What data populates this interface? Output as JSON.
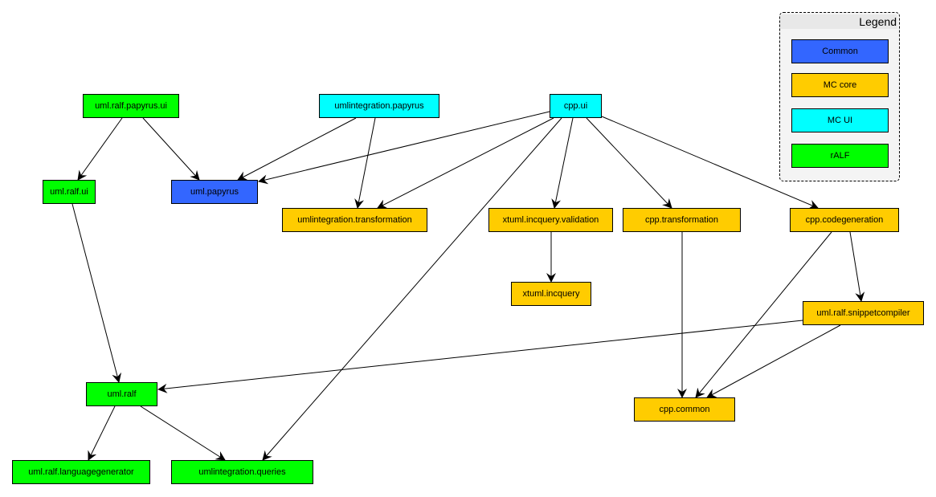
{
  "colors": {
    "Common": "#3366ff",
    "MC core": "#ffcc00",
    "MC UI": "#00ffff",
    "rALF": "#00ff00"
  },
  "legend": {
    "title": "Legend",
    "items": [
      {
        "label": "Common",
        "category": "Common"
      },
      {
        "label": "MC core",
        "category": "MC core"
      },
      {
        "label": "MC UI",
        "category": "MC UI"
      },
      {
        "label": "rALF",
        "category": "rALF"
      }
    ]
  },
  "nodes": [
    {
      "id": "uml.ralf.papyrus.ui",
      "label": "uml.ralf.papyrus.ui",
      "category": "rALF"
    },
    {
      "id": "umlintegration.papyrus",
      "label": "umlintegration.papyrus",
      "category": "MC UI"
    },
    {
      "id": "cpp.ui",
      "label": "cpp.ui",
      "category": "MC UI"
    },
    {
      "id": "uml.ralf.ui",
      "label": "uml.ralf.ui",
      "category": "rALF"
    },
    {
      "id": "uml.papyrus",
      "label": "uml.papyrus",
      "category": "Common"
    },
    {
      "id": "umlintegration.transformation",
      "label": "umlintegration.transformation",
      "category": "MC core"
    },
    {
      "id": "xtuml.incquery.validation",
      "label": "xtuml.incquery.validation",
      "category": "MC core"
    },
    {
      "id": "cpp.transformation",
      "label": "cpp.transformation",
      "category": "MC core"
    },
    {
      "id": "cpp.codegeneration",
      "label": "cpp.codegeneration",
      "category": "MC core"
    },
    {
      "id": "xtuml.incquery",
      "label": "xtuml.incquery",
      "category": "MC core"
    },
    {
      "id": "uml.ralf.snippetcompiler",
      "label": "uml.ralf.snippetcompiler",
      "category": "MC core"
    },
    {
      "id": "uml.ralf",
      "label": "uml.ralf",
      "category": "rALF"
    },
    {
      "id": "cpp.common",
      "label": "cpp.common",
      "category": "MC core"
    },
    {
      "id": "uml.ralf.languagegenerator",
      "label": "uml.ralf.languagegenerator",
      "category": "rALF"
    },
    {
      "id": "umlintegration.queries",
      "label": "umlintegration.queries",
      "category": "rALF"
    }
  ],
  "edges": [
    {
      "from": "uml.ralf.papyrus.ui",
      "to": "uml.ralf.ui"
    },
    {
      "from": "uml.ralf.papyrus.ui",
      "to": "uml.papyrus"
    },
    {
      "from": "umlintegration.papyrus",
      "to": "uml.papyrus"
    },
    {
      "from": "umlintegration.papyrus",
      "to": "umlintegration.transformation"
    },
    {
      "from": "cpp.ui",
      "to": "uml.papyrus"
    },
    {
      "from": "cpp.ui",
      "to": "umlintegration.transformation"
    },
    {
      "from": "cpp.ui",
      "to": "umlintegration.queries"
    },
    {
      "from": "cpp.ui",
      "to": "xtuml.incquery.validation"
    },
    {
      "from": "cpp.ui",
      "to": "cpp.transformation"
    },
    {
      "from": "cpp.ui",
      "to": "cpp.codegeneration"
    },
    {
      "from": "uml.ralf.ui",
      "to": "uml.ralf"
    },
    {
      "from": "xtuml.incquery.validation",
      "to": "xtuml.incquery"
    },
    {
      "from": "cpp.transformation",
      "to": "cpp.common"
    },
    {
      "from": "cpp.codegeneration",
      "to": "cpp.common"
    },
    {
      "from": "cpp.codegeneration",
      "to": "uml.ralf.snippetcompiler"
    },
    {
      "from": "uml.ralf.snippetcompiler",
      "to": "uml.ralf"
    },
    {
      "from": "uml.ralf.snippetcompiler",
      "to": "cpp.common"
    },
    {
      "from": "uml.ralf",
      "to": "uml.ralf.languagegenerator"
    },
    {
      "from": "uml.ralf",
      "to": "umlintegration.queries"
    }
  ]
}
